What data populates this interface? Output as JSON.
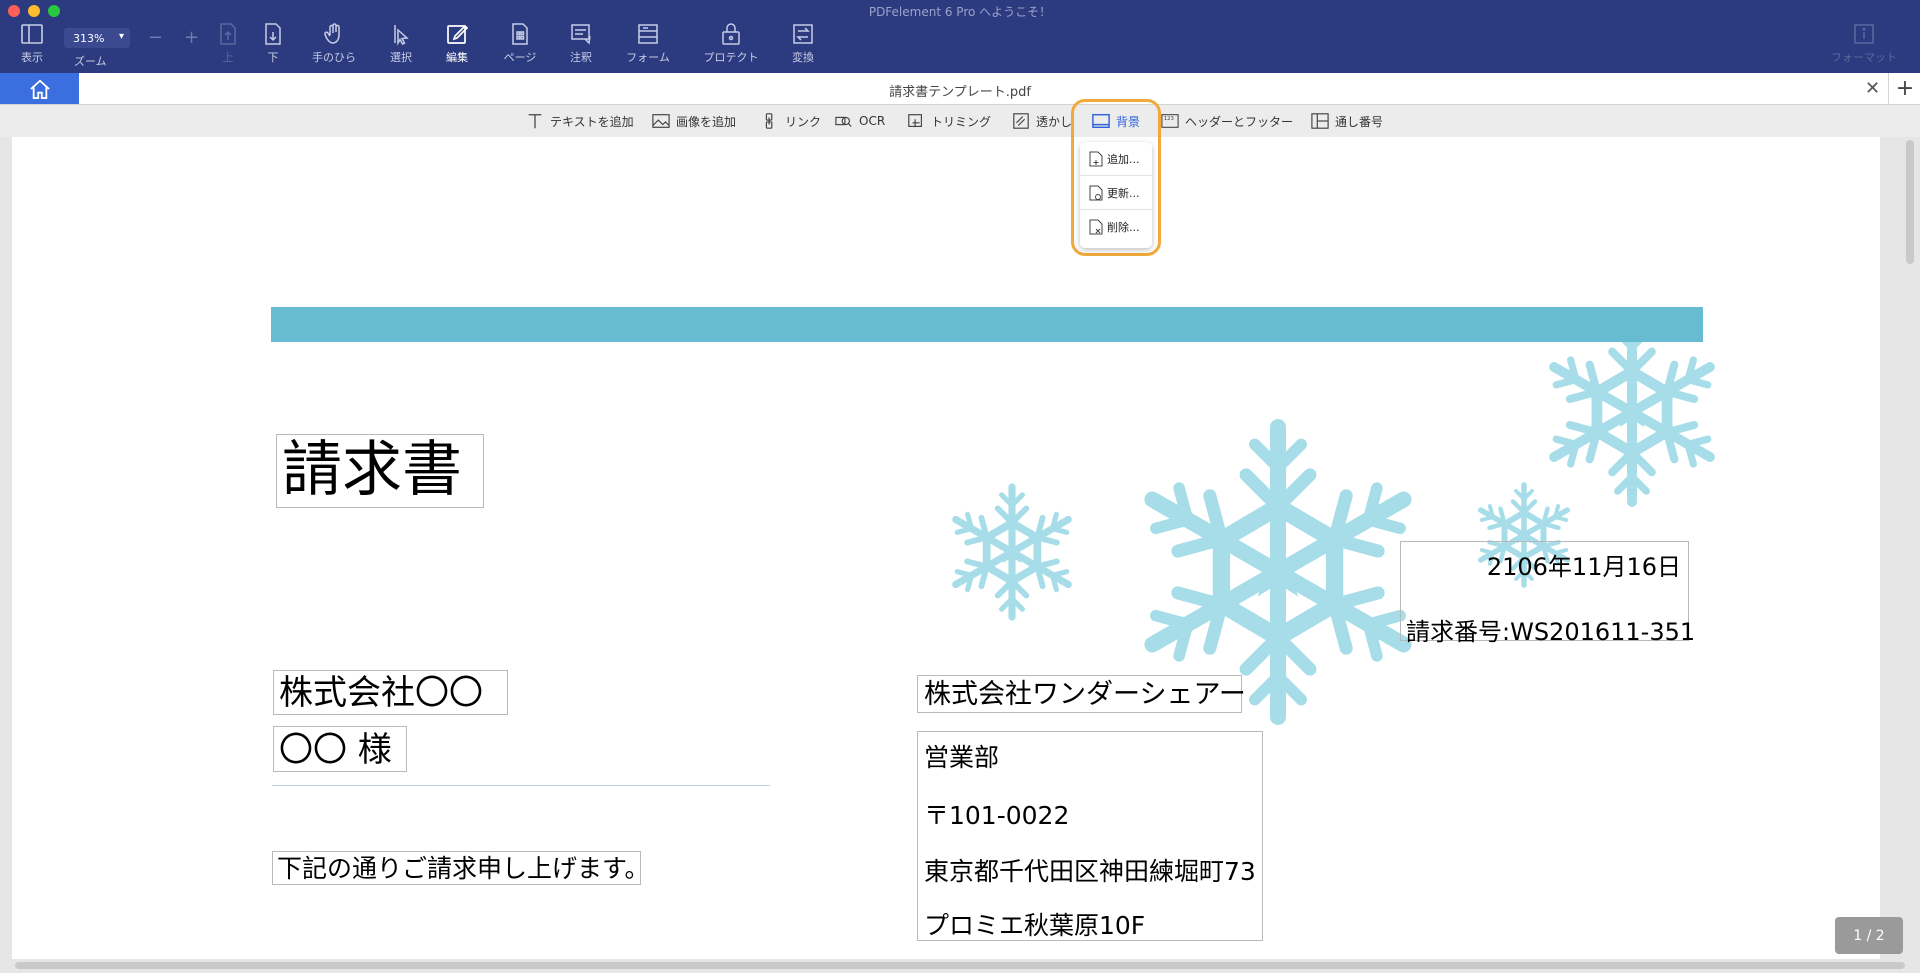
{
  "window": {
    "title": "PDFelement 6 Pro へようこそ！",
    "traffic_colors": [
      "#ff5f57",
      "#febc2e",
      "#28c840"
    ]
  },
  "toolbar": {
    "view_label": "表示",
    "zoom_value": "313%",
    "zoom_label": "ズーム",
    "zoom_out": "−",
    "zoom_in": "+",
    "up_label": "上",
    "down_label": "下",
    "hand_label": "手のひら",
    "select_label": "選択",
    "edit_label": "編集",
    "page_label": "ページ",
    "annotate_label": "注釈",
    "form_label": "フォーム",
    "protect_label": "プロテクト",
    "convert_label": "変換",
    "format_label": "フォーマット"
  },
  "tabs": {
    "doc_title": "請求書テンプレート.pdf",
    "close": "✕",
    "add": "+"
  },
  "edit_toolbar": {
    "add_text": "テキストを追加",
    "add_image": "画像を追加",
    "link": "リンク",
    "ocr": "OCR",
    "trim": "トリミング",
    "watermark": "透かし",
    "background": "背景",
    "header_footer": "ヘッダーとフッター",
    "bates": "通し番号"
  },
  "background_menu": {
    "items": [
      "追加...",
      "更新...",
      "削除..."
    ]
  },
  "document": {
    "title": "請求書",
    "client_company": "株式会社〇〇",
    "client_name": "〇〇 様",
    "greeting": "下記の通りご請求申し上げます。",
    "seller_company": "株式会社ワンダーシェアー",
    "seller_dept": "営業部",
    "seller_postal": "〒101-0022",
    "seller_address": "東京都千代田区神田練堀町73",
    "seller_building": "プロミエ秋葉原10F",
    "date": "2106年11月16日",
    "invoice_number": "請求番号:WS201611-351"
  },
  "status": {
    "page_indicator": "1 / 2"
  },
  "colors": {
    "toolbar_bg": "#2c3a7f",
    "accent": "#3b6fe0",
    "highlight": "#f0a93a",
    "band": "#68bcd2",
    "snowflake": "#a7dde8"
  }
}
